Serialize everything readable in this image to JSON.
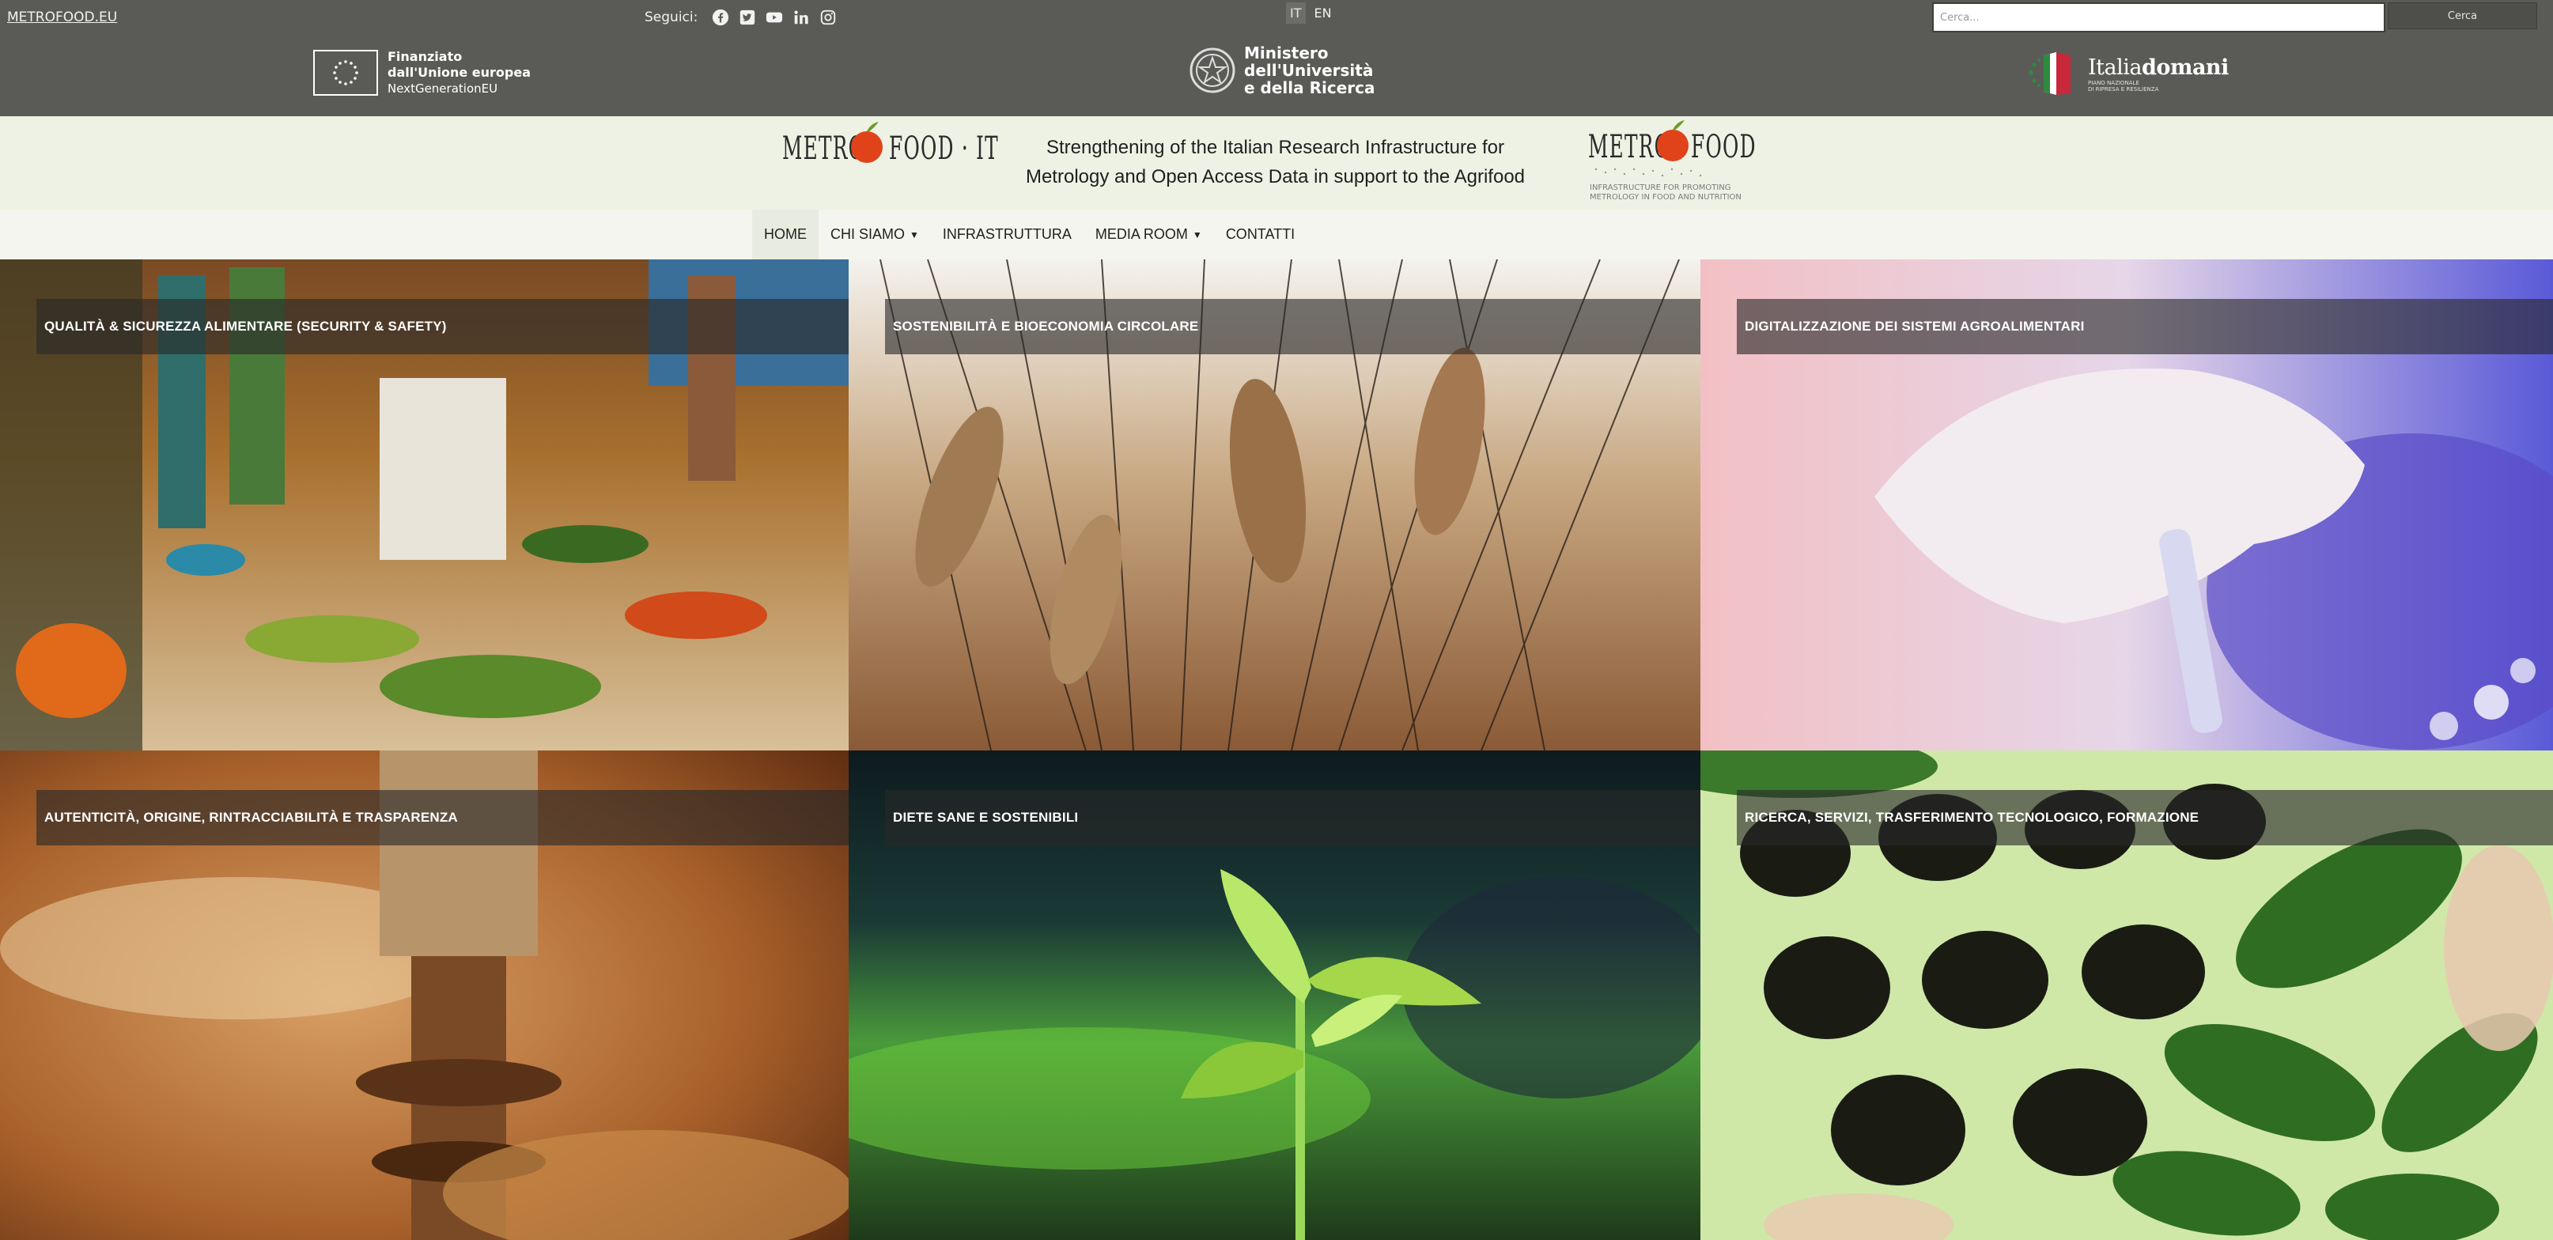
{
  "topbar": {
    "site_link": "METROFOOD.EU",
    "follow_label": "Seguici:",
    "social": [
      "facebook-icon",
      "twitter-icon",
      "youtube-icon",
      "linkedin-icon",
      "instagram-icon"
    ],
    "languages": [
      {
        "label": "IT",
        "active": true
      },
      {
        "label": "EN",
        "active": false
      }
    ],
    "search": {
      "placeholder": "Cerca...",
      "value": "",
      "button": "Cerca"
    },
    "eu_logo": {
      "line1": "Finanziato",
      "line2": "dall'Unione europea",
      "line3": "NextGenerationEU"
    },
    "ministry_logo": {
      "line1": "Ministero",
      "line2": "dell'Università",
      "line3": "e della Ricerca"
    },
    "italia_logo": {
      "word_prefix": "Italia",
      "word_suffix": "domani",
      "sub1": "PIANO NAZIONALE",
      "sub2": "DI RIPRESA E RESILIENZA"
    }
  },
  "header": {
    "left_logo": {
      "part1": "METRO",
      "part2": "FOOD · IT"
    },
    "tagline_line1": "Strengthening of the Italian Research Infrastructure for",
    "tagline_line2": "Metrology and Open Access Data in support to the Agrifood",
    "right_logo": {
      "part1": "METRO",
      "part2": "FOOD",
      "caption1": "INFRASTRUCTURE FOR PROMOTING",
      "caption2": "METROLOGY IN FOOD AND NUTRITION"
    }
  },
  "nav": {
    "items": [
      {
        "label": "HOME",
        "active": true,
        "dropdown": false
      },
      {
        "label": "CHI SIAMO",
        "active": false,
        "dropdown": true
      },
      {
        "label": "INFRASTRUTTURA",
        "active": false,
        "dropdown": false
      },
      {
        "label": "MEDIA ROOM",
        "active": false,
        "dropdown": true
      },
      {
        "label": "CONTATTI",
        "active": false,
        "dropdown": false
      }
    ]
  },
  "tiles": [
    {
      "label": "QUALITÀ & SICUREZZA ALIMENTARE (SECURITY & SAFETY)"
    },
    {
      "label": "SOSTENIBILITÀ E BIOECONOMIA CIRCOLARE"
    },
    {
      "label": "DIGITALIZZAZIONE DEI SISTEMI AGROALIMENTARI"
    },
    {
      "label": "AUTENTICITÀ, ORIGINE, RINTRACCIABILITÀ E TRASPARENZA"
    },
    {
      "label": "DIETE SANE E SOSTENIBILI"
    },
    {
      "label": "RICERCA, SERVIZI, TRASFERIMENTO TECNOLOGICO, FORMAZIONE"
    }
  ],
  "colors": {
    "topbar": "#5a5b57",
    "header_band": "#eef2e4",
    "nav_bg": "#f3f5ee",
    "tomato": "#e0421a",
    "label_overlay": "rgba(40,40,40,0.62)"
  }
}
